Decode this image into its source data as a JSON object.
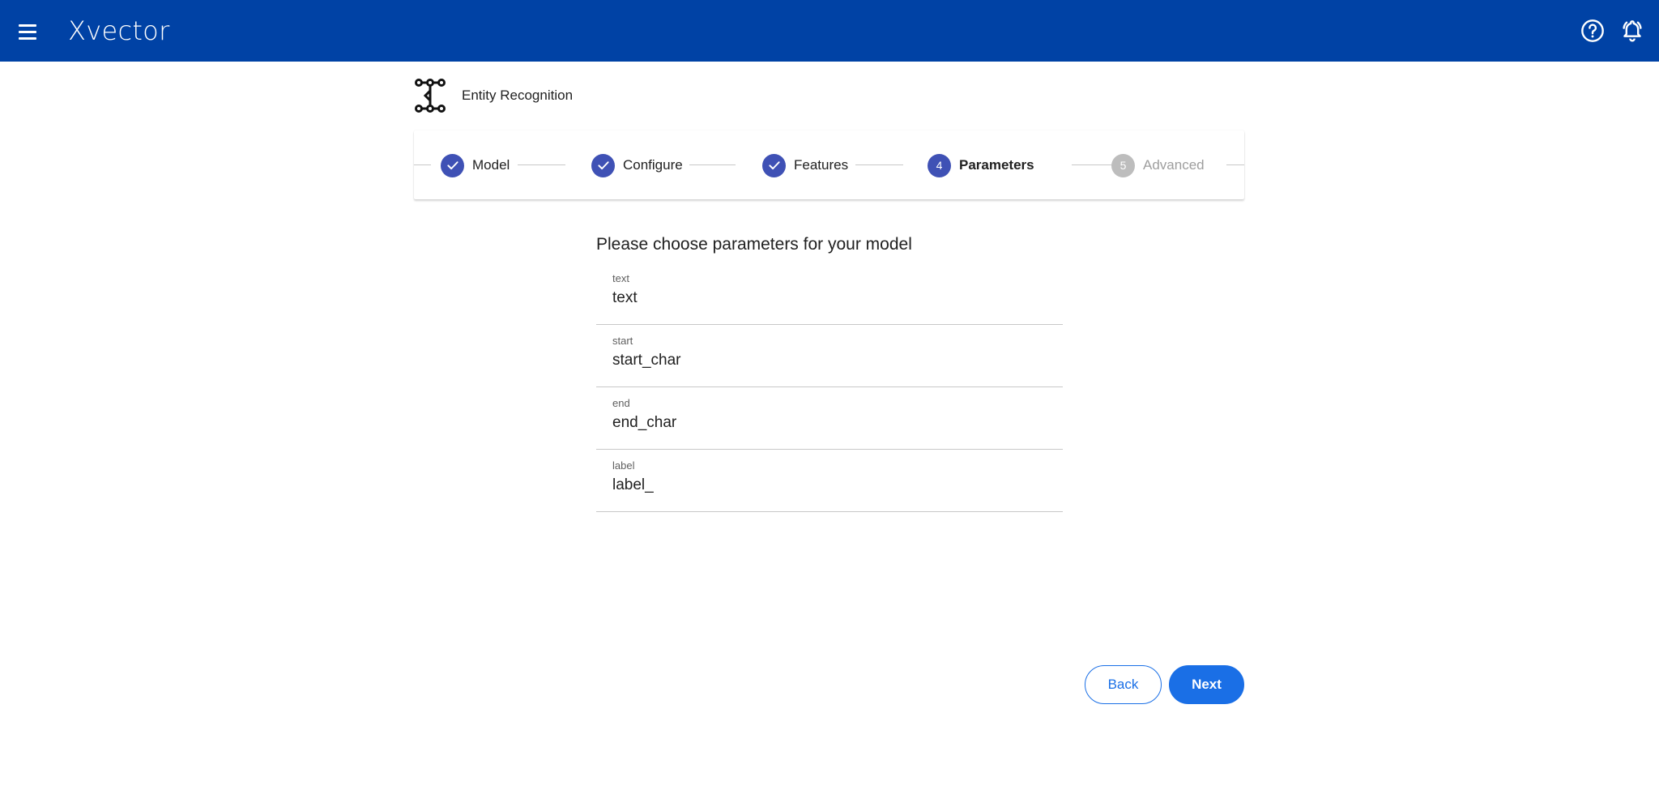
{
  "topbar": {
    "brand": "Xvector",
    "background_color": "#0042a5",
    "menu_icon": "hamburger-menu-icon",
    "help_icon": "help-circle-icon",
    "notification_icon": "bell-icon"
  },
  "page": {
    "title": "Entity Recognition",
    "title_icon": "network-nodes-icon"
  },
  "stepper": {
    "steps": [
      {
        "number": "1",
        "label": "Model",
        "state": "completed"
      },
      {
        "number": "2",
        "label": "Configure",
        "state": "completed"
      },
      {
        "number": "3",
        "label": "Features",
        "state": "completed"
      },
      {
        "number": "4",
        "label": "Parameters",
        "state": "active"
      },
      {
        "number": "5",
        "label": "Advanced",
        "state": "inactive"
      }
    ],
    "active_color": "#3f51b5",
    "inactive_color": "#bdbdbd"
  },
  "form": {
    "heading": "Please choose parameters for your model",
    "fields": [
      {
        "label": "text",
        "value": "text"
      },
      {
        "label": "start",
        "value": "start_char"
      },
      {
        "label": "end",
        "value": "end_char"
      },
      {
        "label": "label",
        "value": "label_"
      }
    ]
  },
  "actions": {
    "back_label": "Back",
    "next_label": "Next",
    "accent_color": "#1a6fe6"
  }
}
